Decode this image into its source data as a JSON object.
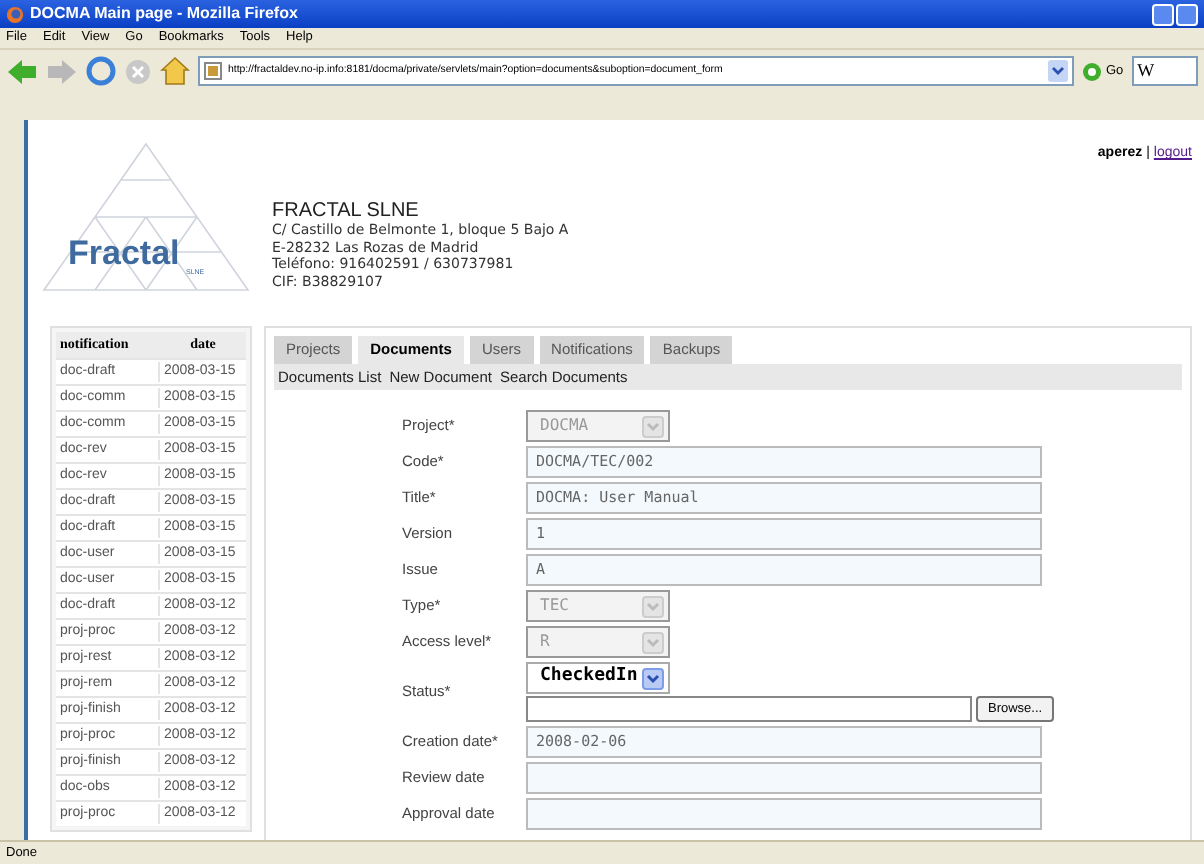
{
  "window": {
    "title": "DOCMA Main page - Mozilla Firefox"
  },
  "menu": [
    "File",
    "Edit",
    "View",
    "Go",
    "Bookmarks",
    "Tools",
    "Help"
  ],
  "address_bar": {
    "url": "http://fractaldev.no-ip.info:8181/docma/private/servlets/main?option=documents&suboption=document_form",
    "go": "Go"
  },
  "search": {
    "engine": "W"
  },
  "user": {
    "name": "aperez",
    "separator": "|",
    "logout": "logout"
  },
  "logo": {
    "name": "Fractal",
    "sub": "SLNE"
  },
  "company": {
    "name": "FRACTAL SLNE",
    "lines": [
      "C/ Castillo de Belmonte 1, bloque 5 Bajo A",
      "E-28232 Las Rozas de Madrid",
      "Teléfono: 916402591 / 630737981",
      "CIF: B38829107"
    ]
  },
  "notifications": {
    "columns": [
      "notification",
      "date"
    ],
    "rows": [
      [
        "doc-draft",
        "2008-03-15"
      ],
      [
        "doc-comm",
        "2008-03-15"
      ],
      [
        "doc-comm",
        "2008-03-15"
      ],
      [
        "doc-rev",
        "2008-03-15"
      ],
      [
        "doc-rev",
        "2008-03-15"
      ],
      [
        "doc-draft",
        "2008-03-15"
      ],
      [
        "doc-draft",
        "2008-03-15"
      ],
      [
        "doc-user",
        "2008-03-15"
      ],
      [
        "doc-user",
        "2008-03-15"
      ],
      [
        "doc-draft",
        "2008-03-12"
      ],
      [
        "proj-proc",
        "2008-03-12"
      ],
      [
        "proj-rest",
        "2008-03-12"
      ],
      [
        "proj-rem",
        "2008-03-12"
      ],
      [
        "proj-finish",
        "2008-03-12"
      ],
      [
        "proj-proc",
        "2008-03-12"
      ],
      [
        "proj-finish",
        "2008-03-12"
      ],
      [
        "doc-obs",
        "2008-03-12"
      ],
      [
        "proj-proc",
        "2008-03-12"
      ]
    ]
  },
  "tabs": [
    {
      "label": "Projects",
      "selected": false
    },
    {
      "label": "Documents",
      "selected": true
    },
    {
      "label": "Users",
      "selected": false
    },
    {
      "label": "Notifications",
      "selected": false
    },
    {
      "label": "Backups",
      "selected": false
    }
  ],
  "subnav": [
    "Documents List",
    "New Document",
    "Search Documents"
  ],
  "form": [
    {
      "kind": "select",
      "label": "Project*",
      "value": "DOCMA",
      "disabled": true
    },
    {
      "kind": "text",
      "label": "Code*",
      "value": "DOCMA/TEC/002"
    },
    {
      "kind": "text",
      "label": "Title*",
      "value": "DOCMA: User Manual"
    },
    {
      "kind": "text",
      "label": "Version",
      "value": "1"
    },
    {
      "kind": "text",
      "label": "Issue",
      "value": "A"
    },
    {
      "kind": "select",
      "label": "Type*",
      "value": "TEC",
      "disabled": true
    },
    {
      "kind": "select",
      "label": "Access level*",
      "value": "R",
      "disabled": true
    },
    {
      "kind": "status",
      "label": "Status*",
      "value": "CheckedIn",
      "disabled": false,
      "button": "Browse..."
    },
    {
      "kind": "text",
      "label": "Creation date*",
      "value": "2008-02-06"
    },
    {
      "kind": "text",
      "label": "Review date"
    },
    {
      "kind": "text",
      "label": "Approval date"
    }
  ],
  "status_bar": "Done"
}
